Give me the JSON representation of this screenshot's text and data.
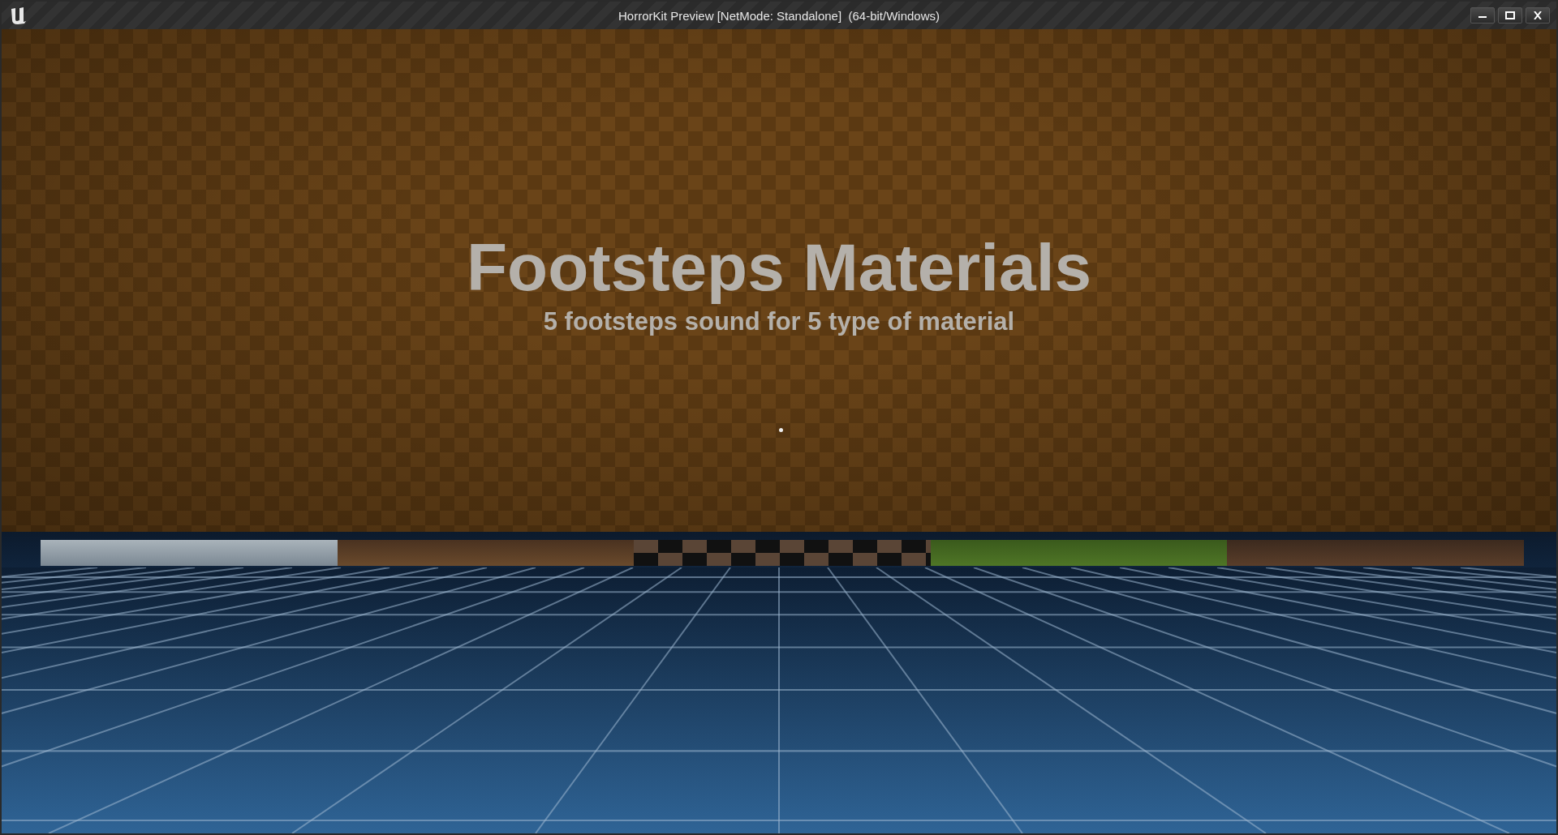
{
  "window": {
    "title": "HorrorKit Preview [NetMode: Standalone]  (64-bit/Windows)"
  },
  "scene": {
    "heading": "Footsteps Materials",
    "subheading": "5 footsteps sound for 5 type of material"
  }
}
